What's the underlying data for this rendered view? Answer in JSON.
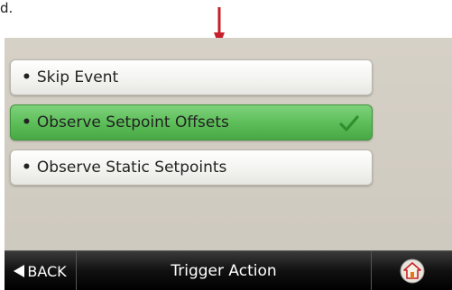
{
  "page_fragment": "d.",
  "options": [
    {
      "label": "Skip Event",
      "selected": false
    },
    {
      "label": "Observe Setpoint Offsets",
      "selected": true
    },
    {
      "label": "Observe Static Setpoints",
      "selected": false
    }
  ],
  "bullet": "•",
  "footer": {
    "back_label": "BACK",
    "title": "Trigger Action"
  },
  "colors": {
    "callout_arrow": "#c8202a",
    "selected_bg": "#5bbd57",
    "check": "#3aa13a"
  },
  "icons": {
    "callout": "down-arrow-icon",
    "selected": "checkmark-icon",
    "back": "left-triangle-icon",
    "home": "home-icon"
  }
}
